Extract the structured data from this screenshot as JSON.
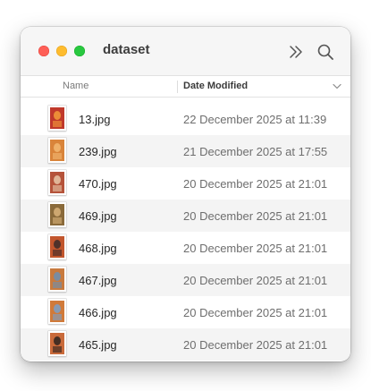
{
  "window": {
    "title": "dataset"
  },
  "toolbar": {
    "more_icon": "chevron-double-right-icon",
    "search_icon": "search-icon"
  },
  "columns": {
    "name": "Name",
    "date_modified": "Date Modified",
    "sort_icon": "chevron-down-icon"
  },
  "files": [
    {
      "name": "13.jpg",
      "date": "22 December 2025 at 11:39",
      "thumb_bg": "#c0392b",
      "thumb_fg": "#f39c3a"
    },
    {
      "name": "239.jpg",
      "date": "21 December 2025 at 17:55",
      "thumb_bg": "#d9843a",
      "thumb_fg": "#f2b873"
    },
    {
      "name": "470.jpg",
      "date": "20 December 2025 at 21:01",
      "thumb_bg": "#b5533a",
      "thumb_fg": "#e8c7a8"
    },
    {
      "name": "469.jpg",
      "date": "20 December 2025 at 21:01",
      "thumb_bg": "#8a6a3a",
      "thumb_fg": "#d8b27a"
    },
    {
      "name": "468.jpg",
      "date": "20 December 2025 at 21:01",
      "thumb_bg": "#c2562d",
      "thumb_fg": "#3b2a2a"
    },
    {
      "name": "467.jpg",
      "date": "20 December 2025 at 21:01",
      "thumb_bg": "#c87a3e",
      "thumb_fg": "#6b8fb3"
    },
    {
      "name": "466.jpg",
      "date": "20 December 2025 at 21:01",
      "thumb_bg": "#d07a3a",
      "thumb_fg": "#7aa0c9"
    },
    {
      "name": "465.jpg",
      "date": "20 December 2025 at 21:01",
      "thumb_bg": "#c96a3a",
      "thumb_fg": "#2d2320"
    }
  ]
}
